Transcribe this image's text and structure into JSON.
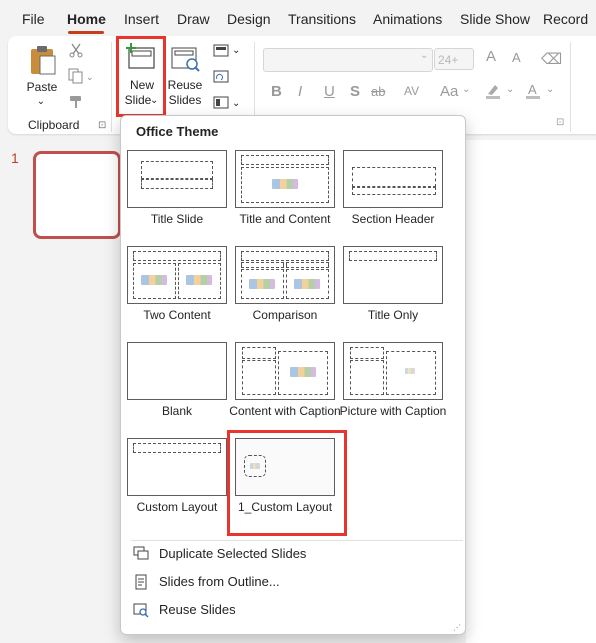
{
  "tabs": [
    "File",
    "Home",
    "Insert",
    "Draw",
    "Design",
    "Transitions",
    "Animations",
    "Slide Show",
    "Record"
  ],
  "active_tab": "Home",
  "ribbon": {
    "paste_label": "Paste",
    "new_slide_line1": "New",
    "new_slide_line2": "Slide",
    "reuse_line1": "Reuse",
    "reuse_line2": "Slides",
    "clipboard_group": "Clipboard",
    "font_size_placeholder": "24+",
    "font_glyphs": [
      "A",
      "A",
      "B",
      "I",
      "U",
      "S",
      "ab",
      "AV",
      "Aa"
    ]
  },
  "thumbnail": {
    "slide_number": "1"
  },
  "dropdown": {
    "title": "Office Theme",
    "layouts": [
      {
        "name": "Title Slide"
      },
      {
        "name": "Title and Content"
      },
      {
        "name": "Section Header"
      },
      {
        "name": "Two Content"
      },
      {
        "name": "Comparison"
      },
      {
        "name": "Title Only"
      },
      {
        "name": "Blank"
      },
      {
        "name": "Content with Caption"
      },
      {
        "name": "Picture with Caption"
      },
      {
        "name": "Custom Layout"
      },
      {
        "name": "1_Custom Layout"
      }
    ],
    "menu": [
      {
        "label": "Duplicate Selected Slides",
        "icon": "duplicate-slides-icon"
      },
      {
        "label": "Slides from Outline...",
        "icon": "outline-icon"
      },
      {
        "label": "Reuse Slides",
        "icon": "reuse-slides-icon"
      }
    ]
  },
  "colors": {
    "accent": "#c43e1c",
    "highlight": "#e8352f",
    "new_slide_green": "#3a9a3a"
  }
}
